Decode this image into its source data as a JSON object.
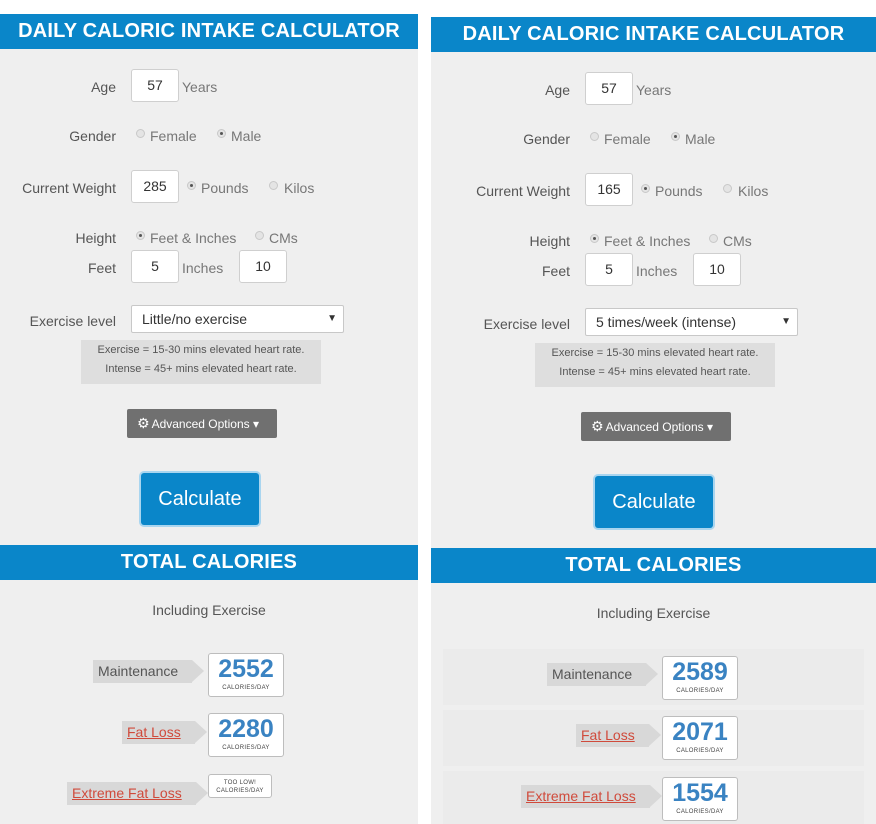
{
  "left": {
    "title": "DAILY CALORIC INTAKE CALCULATOR",
    "age_label": "Age",
    "age_value": "57",
    "age_unit": "Years",
    "gender_label": "Gender",
    "gender_female": "Female",
    "gender_male": "Male",
    "gender_selected": "Male",
    "weight_label": "Current Weight",
    "weight_value": "285",
    "weight_pounds": "Pounds",
    "weight_kilos": "Kilos",
    "weight_unit_selected": "Pounds",
    "height_label": "Height",
    "height_feet_inches": "Feet & Inches",
    "height_cms": "CMs",
    "height_unit_selected": "Feet & Inches",
    "feet_label": "Feet",
    "feet_value": "5",
    "inches_label": "Inches",
    "inches_value": "10",
    "exercise_label": "Exercise level",
    "exercise_value": "Little/no exercise",
    "note_line1": "Exercise = 15-30 mins elevated heart rate.",
    "note_line2": "Intense = 45+ mins elevated heart rate.",
    "advanced_label": "Advanced Options ▾",
    "calculate_label": "Calculate",
    "totals_title": "TOTAL CALORIES",
    "including": "Including Exercise",
    "maintenance_label": "Maintenance",
    "maintenance_value": "2552",
    "fatloss_label": "Fat Loss",
    "fatloss_value": "2280",
    "extreme_label": "Extreme Fat Loss",
    "extreme_value": "TOO LOW!",
    "per_day": "CALORIES/DAY"
  },
  "right": {
    "title": "DAILY CALORIC INTAKE CALCULATOR",
    "age_label": "Age",
    "age_value": "57",
    "age_unit": "Years",
    "gender_label": "Gender",
    "gender_female": "Female",
    "gender_male": "Male",
    "gender_selected": "Male",
    "weight_label": "Current Weight",
    "weight_value": "165",
    "weight_pounds": "Pounds",
    "weight_kilos": "Kilos",
    "weight_unit_selected": "Pounds",
    "height_label": "Height",
    "height_feet_inches": "Feet & Inches",
    "height_cms": "CMs",
    "height_unit_selected": "Feet & Inches",
    "feet_label": "Feet",
    "feet_value": "5",
    "inches_label": "Inches",
    "inches_value": "10",
    "exercise_label": "Exercise level",
    "exercise_value": "5 times/week (intense)",
    "note_line1": "Exercise = 15-30 mins elevated heart rate.",
    "note_line2": "Intense = 45+ mins elevated heart rate.",
    "advanced_label": "Advanced Options ▾",
    "calculate_label": "Calculate",
    "totals_title": "TOTAL CALORIES",
    "including": "Including Exercise",
    "maintenance_label": "Maintenance",
    "maintenance_value": "2589",
    "fatloss_label": "Fat Loss",
    "fatloss_value": "2071",
    "extreme_label": "Extreme Fat Loss",
    "extreme_value": "1554",
    "per_day": "CALORIES/DAY"
  },
  "colors": {
    "header_blue": "#0a86c9",
    "number_blue": "#3a83c2",
    "link_red": "#d04a3b"
  },
  "icons": {
    "advanced": "gear-icon",
    "select": "chevron-down-icon"
  }
}
